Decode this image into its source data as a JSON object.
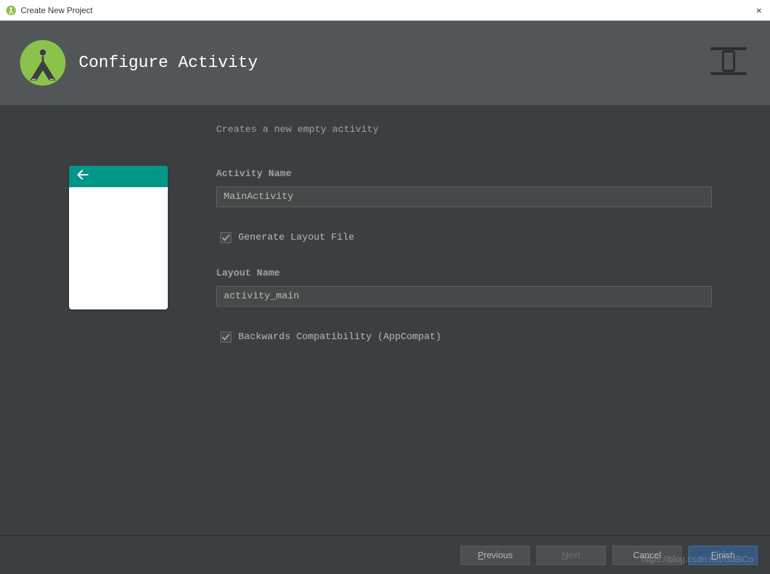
{
  "window": {
    "title": "Create New Project",
    "close": "×"
  },
  "header": {
    "title": "Configure Activity"
  },
  "form": {
    "description": "Creates a new empty activity",
    "activity_name_label": "Activity Name",
    "activity_name_value": "MainActivity",
    "generate_layout_label": "Generate Layout File",
    "generate_layout_checked": true,
    "layout_name_label": "Layout Name",
    "layout_name_value": "activity_main",
    "backwards_compat_label": "Backwards Compatibility (AppCompat)",
    "backwards_compat_checked": true
  },
  "footer": {
    "previous": "Previous",
    "next": "Next",
    "cancel": "Cancel",
    "finish": "Finish"
  },
  "watermark": "https://blog.csdn.net/GaBCo"
}
